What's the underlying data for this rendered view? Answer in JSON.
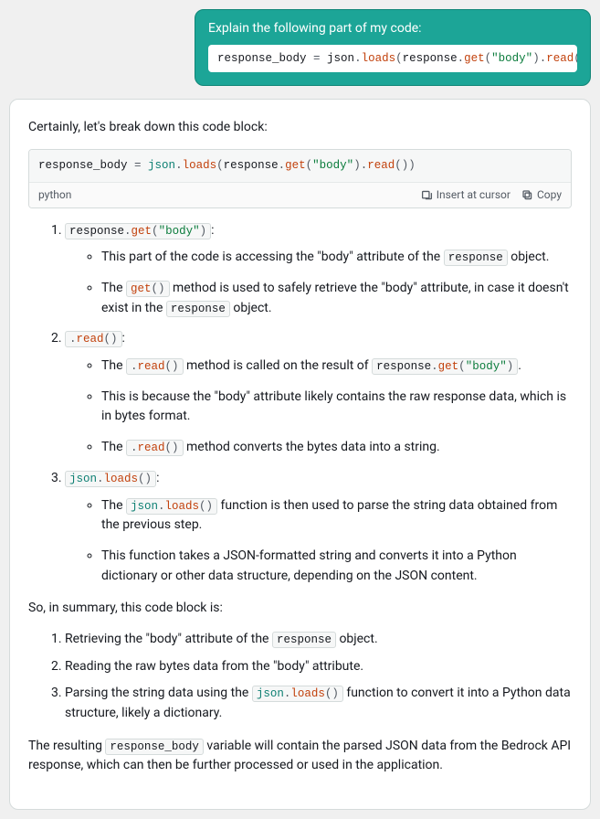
{
  "user_message": {
    "prompt": "Explain the following part of my code:",
    "code_tokens": [
      {
        "t": "response_body ",
        "c": "tok-var"
      },
      {
        "t": "= ",
        "c": "tok-op"
      },
      {
        "t": "json",
        "c": "tok-var"
      },
      {
        "t": ".",
        "c": "tok-punc"
      },
      {
        "t": "loads",
        "c": "tok-fn"
      },
      {
        "t": "(",
        "c": "tok-punc"
      },
      {
        "t": "response",
        "c": "tok-var"
      },
      {
        "t": ".",
        "c": "tok-punc"
      },
      {
        "t": "get",
        "c": "tok-fn"
      },
      {
        "t": "(",
        "c": "tok-punc"
      },
      {
        "t": "\"body\"",
        "c": "tok-str"
      },
      {
        "t": ")",
        "c": "tok-punc"
      },
      {
        "t": ".",
        "c": "tok-punc"
      },
      {
        "t": "read",
        "c": "tok-fn"
      },
      {
        "t": "()",
        "c": "tok-punc"
      },
      {
        "t": ")",
        "c": "tok-punc"
      }
    ]
  },
  "assistant": {
    "intro": "Certainly, let's break down this code block:",
    "codeblock": {
      "lang": "python",
      "insert_label": "Insert at cursor",
      "copy_label": "Copy",
      "tokens": [
        {
          "t": "response_body ",
          "c": "tok-var"
        },
        {
          "t": "= ",
          "c": "tok-op"
        },
        {
          "t": "json",
          "c": "tok-obj"
        },
        {
          "t": ".",
          "c": "tok-punc"
        },
        {
          "t": "loads",
          "c": "tok-fn"
        },
        {
          "t": "(",
          "c": "tok-punc"
        },
        {
          "t": "response",
          "c": "tok-var"
        },
        {
          "t": ".",
          "c": "tok-punc"
        },
        {
          "t": "get",
          "c": "tok-fn"
        },
        {
          "t": "(",
          "c": "tok-punc"
        },
        {
          "t": "\"body\"",
          "c": "tok-str"
        },
        {
          "t": ")",
          "c": "tok-punc"
        },
        {
          "t": ".",
          "c": "tok-punc"
        },
        {
          "t": "read",
          "c": "tok-fn"
        },
        {
          "t": "()",
          "c": "tok-punc"
        },
        {
          "t": ")",
          "c": "tok-punc"
        }
      ]
    },
    "steps": [
      {
        "head_tokens": [
          {
            "t": "response",
            "c": "tok-var"
          },
          {
            "t": ".",
            "c": "tok-punc"
          },
          {
            "t": "get",
            "c": "tok-fn"
          },
          {
            "t": "(",
            "c": "tok-punc"
          },
          {
            "t": "\"body\"",
            "c": "tok-str"
          },
          {
            "t": ")",
            "c": "tok-punc"
          }
        ],
        "tail": ":",
        "bullets": [
          [
            {
              "t": "This part of the code is accessing the \"body\" attribute of the "
            },
            {
              "code": [
                {
                  "t": "response",
                  "c": "tok-var"
                }
              ]
            },
            {
              "t": " object."
            }
          ],
          [
            {
              "t": "The "
            },
            {
              "code": [
                {
                  "t": "get",
                  "c": "tok-fn"
                },
                {
                  "t": "()",
                  "c": "tok-punc"
                }
              ]
            },
            {
              "t": " method is used to safely retrieve the \"body\" attribute, in case it doesn't exist in the "
            },
            {
              "code": [
                {
                  "t": "response",
                  "c": "tok-var"
                }
              ]
            },
            {
              "t": " object."
            }
          ]
        ]
      },
      {
        "head_tokens": [
          {
            "t": ".",
            "c": "tok-punc"
          },
          {
            "t": "read",
            "c": "tok-fn"
          },
          {
            "t": "()",
            "c": "tok-punc"
          }
        ],
        "tail": ":",
        "bullets": [
          [
            {
              "t": "The "
            },
            {
              "code": [
                {
                  "t": ".",
                  "c": "tok-punc"
                },
                {
                  "t": "read",
                  "c": "tok-fn"
                },
                {
                  "t": "()",
                  "c": "tok-punc"
                }
              ]
            },
            {
              "t": " method is called on the result of "
            },
            {
              "code": [
                {
                  "t": "response",
                  "c": "tok-var"
                },
                {
                  "t": ".",
                  "c": "tok-punc"
                },
                {
                  "t": "get",
                  "c": "tok-fn"
                },
                {
                  "t": "(",
                  "c": "tok-punc"
                },
                {
                  "t": "\"body\"",
                  "c": "tok-str"
                },
                {
                  "t": ")",
                  "c": "tok-punc"
                }
              ]
            },
            {
              "t": "."
            }
          ],
          [
            {
              "t": "This is because the \"body\" attribute likely contains the raw response data, which is in bytes format."
            }
          ],
          [
            {
              "t": "The "
            },
            {
              "code": [
                {
                  "t": ".",
                  "c": "tok-punc"
                },
                {
                  "t": "read",
                  "c": "tok-fn"
                },
                {
                  "t": "()",
                  "c": "tok-punc"
                }
              ]
            },
            {
              "t": " method converts the bytes data into a string."
            }
          ]
        ]
      },
      {
        "head_tokens": [
          {
            "t": "json",
            "c": "tok-obj"
          },
          {
            "t": ".",
            "c": "tok-punc"
          },
          {
            "t": "loads",
            "c": "tok-fn"
          },
          {
            "t": "()",
            "c": "tok-punc"
          }
        ],
        "tail": ":",
        "bullets": [
          [
            {
              "t": "The "
            },
            {
              "code": [
                {
                  "t": "json",
                  "c": "tok-obj"
                },
                {
                  "t": ".",
                  "c": "tok-punc"
                },
                {
                  "t": "loads",
                  "c": "tok-fn"
                },
                {
                  "t": "()",
                  "c": "tok-punc"
                }
              ]
            },
            {
              "t": " function is then used to parse the string data obtained from the previous step."
            }
          ],
          [
            {
              "t": "This function takes a JSON-formatted string and converts it into a Python dictionary or other data structure, depending on the JSON content."
            }
          ]
        ]
      }
    ],
    "summary_intro": "So, in summary, this code block is:",
    "summary": [
      [
        {
          "t": "Retrieving the \"body\" attribute of the "
        },
        {
          "code": [
            {
              "t": "response",
              "c": "tok-var"
            }
          ]
        },
        {
          "t": " object."
        }
      ],
      [
        {
          "t": "Reading the raw bytes data from the \"body\" attribute."
        }
      ],
      [
        {
          "t": "Parsing the string data using the "
        },
        {
          "code": [
            {
              "t": "json",
              "c": "tok-obj"
            },
            {
              "t": ".",
              "c": "tok-punc"
            },
            {
              "t": "loads",
              "c": "tok-fn"
            },
            {
              "t": "()",
              "c": "tok-punc"
            }
          ]
        },
        {
          "t": " function to convert it into a Python data structure, likely a dictionary."
        }
      ]
    ],
    "closing": [
      {
        "t": "The resulting "
      },
      {
        "code": [
          {
            "t": "response_body",
            "c": "tok-var"
          }
        ]
      },
      {
        "t": " variable will contain the parsed JSON data from the Bedrock API response, which can then be further processed or used in the application."
      }
    ]
  }
}
